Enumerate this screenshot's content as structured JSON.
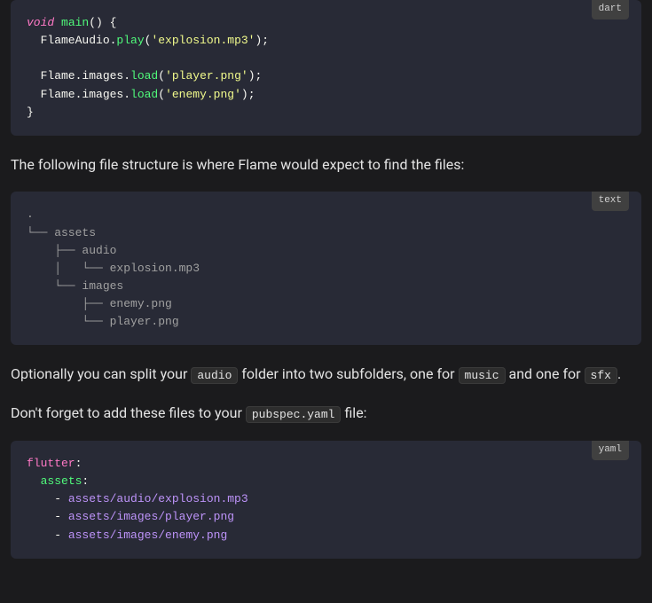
{
  "block1": {
    "lang": "dart",
    "code": {
      "l1_kw": "void",
      "l1_fn": "main",
      "l1_rest": "() {",
      "l2a": "  FlameAudio.",
      "l2b": "play",
      "l2c": "(",
      "l2d": "'explosion.mp3'",
      "l2e": ");",
      "l3a": "  Flame.images.",
      "l3b": "load",
      "l3c": "(",
      "l3d": "'player.png'",
      "l3e": ");",
      "l4a": "  Flame.images.",
      "l4b": "load",
      "l4c": "(",
      "l4d": "'enemy.png'",
      "l4e": ");",
      "l5": "}"
    }
  },
  "para1": "The following file structure is where Flame would expect to find the files:",
  "block2": {
    "lang": "text",
    "tree": {
      "l1": ".",
      "l2": "└── assets",
      "l3": "    ├── audio",
      "l4": "    │   └── explosion.mp3",
      "l5": "    └── images",
      "l6": "        ├── enemy.png",
      "l7": "        └── player.png"
    }
  },
  "para2": {
    "t1": "Optionally you can split your ",
    "c1": "audio",
    "t2": " folder into two subfolders, one for ",
    "c2": "music",
    "t3": " and one for ",
    "c3": "sfx",
    "t4": "."
  },
  "para3": {
    "t1": "Don't forget to add these files to your ",
    "c1": "pubspec.yaml",
    "t2": " file:"
  },
  "block3": {
    "lang": "yaml",
    "yaml": {
      "k1": "flutter",
      "col": ":",
      "k2": "assets",
      "dash": "- ",
      "v1": "assets/audio/explosion.mp3",
      "v2": "assets/images/player.png",
      "v3": "assets/images/enemy.png"
    }
  }
}
